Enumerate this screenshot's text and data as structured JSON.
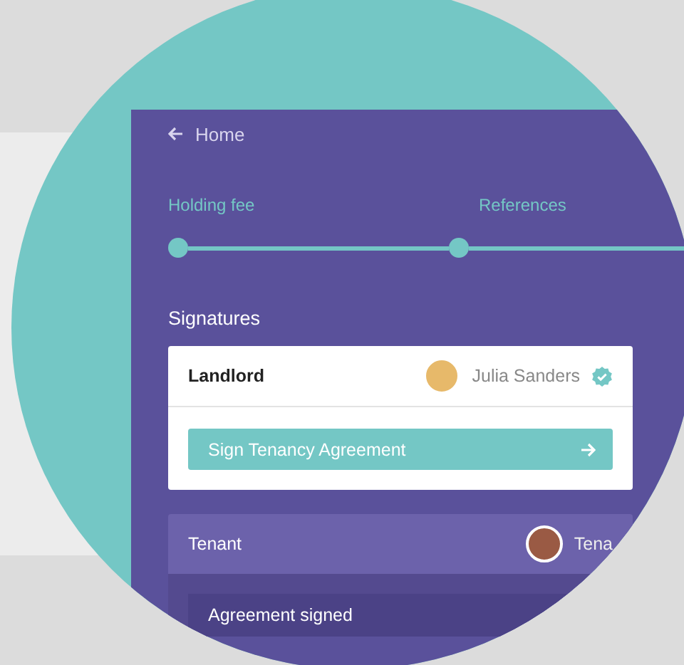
{
  "nav": {
    "back_label": "Home"
  },
  "steps": [
    {
      "label": "Holding fee"
    },
    {
      "label": "References"
    }
  ],
  "signatures": {
    "title": "Signatures",
    "signers": [
      {
        "kind": "active",
        "role": "Landlord",
        "name": "Julia Sanders",
        "verified": true,
        "action": "Sign Tenancy Agreement"
      },
      {
        "kind": "done",
        "role": "Tenant",
        "name": "Tena",
        "verified": false,
        "note": "Agreement signed"
      }
    ]
  }
}
